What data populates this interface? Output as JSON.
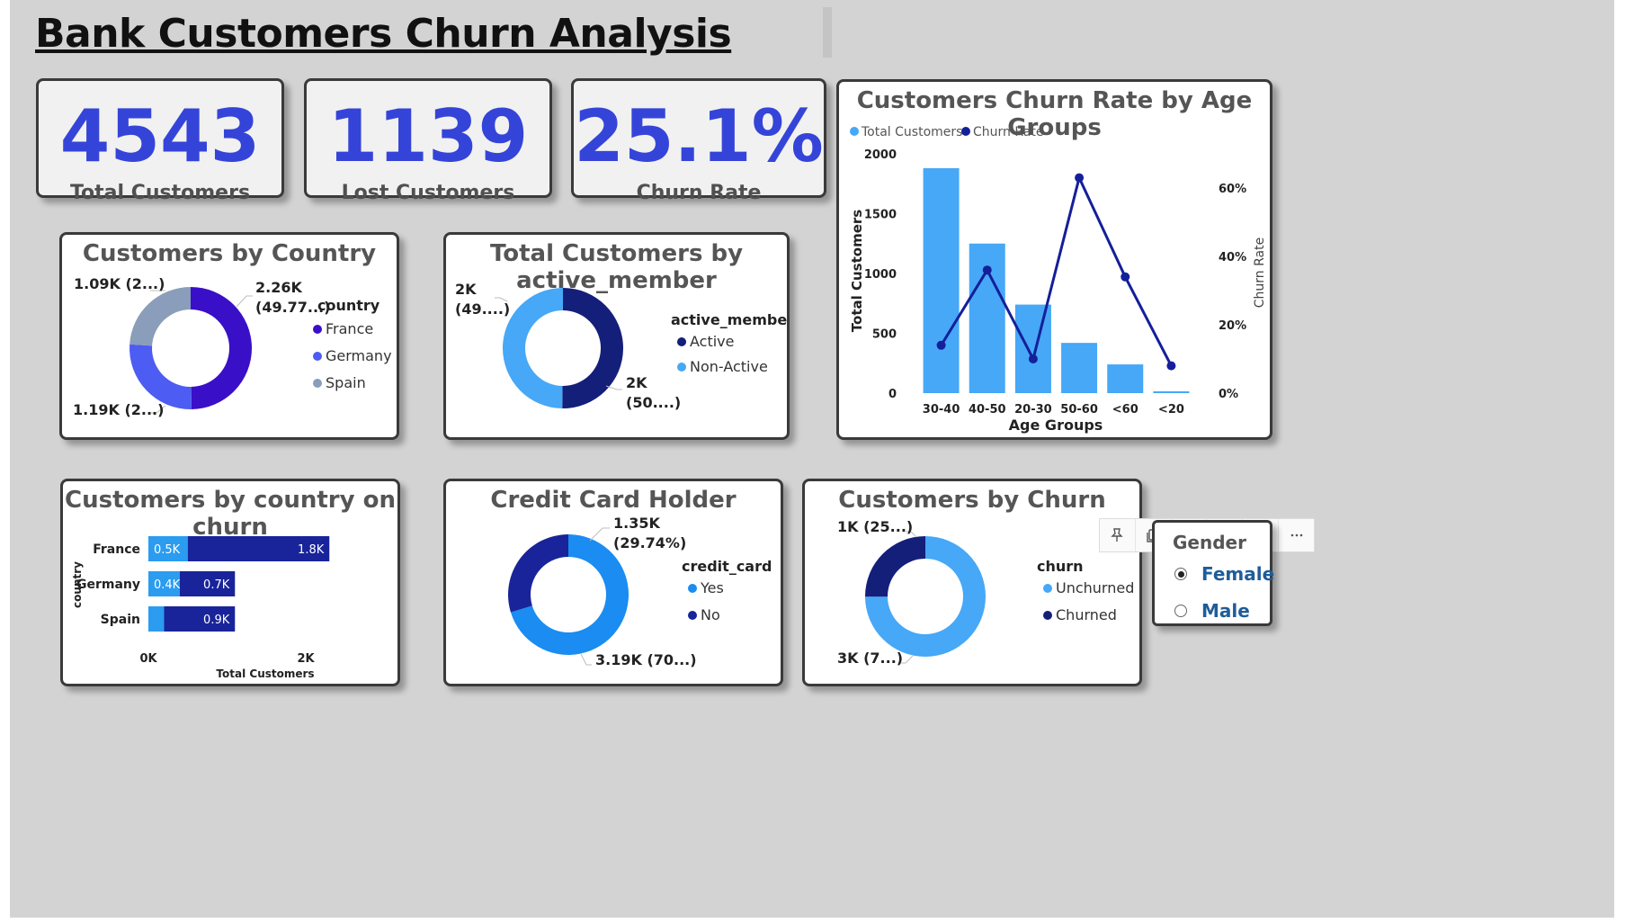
{
  "title": "Bank Customers Churn Analysis",
  "kpis": [
    {
      "value": "4543",
      "label": "Total Customers"
    },
    {
      "value": "1139",
      "label": "Lost Customers"
    },
    {
      "value": "25.1%",
      "label": "Churn Rate"
    }
  ],
  "toolbar": {
    "icons": [
      "pin-icon",
      "copy-icon",
      "bell-icon",
      "filter-icon",
      "focus-mode-icon",
      "more-options-icon"
    ]
  },
  "slicer": {
    "title": "Gender",
    "options": [
      "Female",
      "Male"
    ],
    "selected": "Female"
  },
  "chart_data": [
    {
      "id": "country",
      "type": "pie",
      "title": "Customers by Country",
      "legend_title": "country",
      "categories": [
        "France",
        "Germany",
        "Spain"
      ],
      "values": [
        2260,
        1190,
        1090
      ],
      "labels": [
        [
          "2.26K",
          "(49.77...)"
        ],
        [
          "1.19K (2...)"
        ],
        [
          "1.09K (2...)"
        ]
      ],
      "colors": [
        "#3a0fc8",
        "#4d5cf2",
        "#8a9dba"
      ]
    },
    {
      "id": "active",
      "type": "pie",
      "title": "Total Customers by active_member",
      "legend_title": "active_member",
      "categories": [
        "Active",
        "Non-Active"
      ],
      "values": [
        2280,
        2263
      ],
      "labels": [
        [
          "2K",
          "(50....)"
        ],
        [
          "2K",
          "(49....)"
        ]
      ],
      "colors": [
        "#141f7a",
        "#46a8f6"
      ]
    },
    {
      "id": "credit",
      "type": "pie",
      "title": "Credit Card Holder",
      "legend_title": "credit_card",
      "categories": [
        "Yes",
        "No"
      ],
      "values": [
        3190,
        1350
      ],
      "labels": [
        [
          "3.19K (70...)"
        ],
        [
          "1.35K",
          "(29.74%)"
        ]
      ],
      "colors": [
        "#1a8cf2",
        "#19249a"
      ]
    },
    {
      "id": "churn",
      "type": "pie",
      "title": "Customers by Churn",
      "legend_title": "churn",
      "categories": [
        "Unchurned",
        "Churned"
      ],
      "values": [
        3404,
        1139
      ],
      "labels": [
        [
          "3K (7...)"
        ],
        [
          "1K (25...)"
        ]
      ],
      "colors": [
        "#46a8f6",
        "#141f7a"
      ]
    },
    {
      "id": "country_churn",
      "type": "bar",
      "orientation": "horizontal",
      "stacked": true,
      "title": "Customers by country on churn",
      "categories": [
        "France",
        "Germany",
        "Spain"
      ],
      "series": [
        {
          "values": [
            500,
            400,
            200
          ],
          "labels": [
            "0.5K",
            "0.4K",
            ""
          ],
          "color": "#2b9cf0"
        },
        {
          "values": [
            1800,
            700,
            900
          ],
          "labels": [
            "1.8K",
            "0.7K",
            "0.9K"
          ],
          "color": "#19249a"
        }
      ],
      "xlabel": "Total Customers",
      "ylabel": "country",
      "xlim": [
        0,
        2000
      ],
      "xticks": [
        "0K",
        "2K"
      ]
    },
    {
      "id": "age",
      "type": "bar",
      "title": "Customers Churn Rate by Age Groups",
      "legend": [
        "Total Customers",
        "Churn Rate"
      ],
      "categories": [
        "30-40",
        "40-50",
        "20-30",
        "50-60",
        "<60",
        "<20"
      ],
      "bar_values": [
        1880,
        1250,
        740,
        420,
        240,
        15
      ],
      "line_values": [
        0.14,
        0.36,
        0.1,
        0.63,
        0.34,
        0.08
      ],
      "xlabel": "Age Groups",
      "ylabel": "Total Customers",
      "y2label": "Churn Rate",
      "ylim": [
        0,
        2000
      ],
      "yticks": [
        "0",
        "500",
        "1000",
        "1500",
        "2000"
      ],
      "y2lim": [
        0,
        0.7
      ],
      "y2ticks": [
        "0%",
        "20%",
        "40%",
        "60%"
      ],
      "bar_color": "#46a8f6",
      "line_color": "#141f9a"
    }
  ]
}
